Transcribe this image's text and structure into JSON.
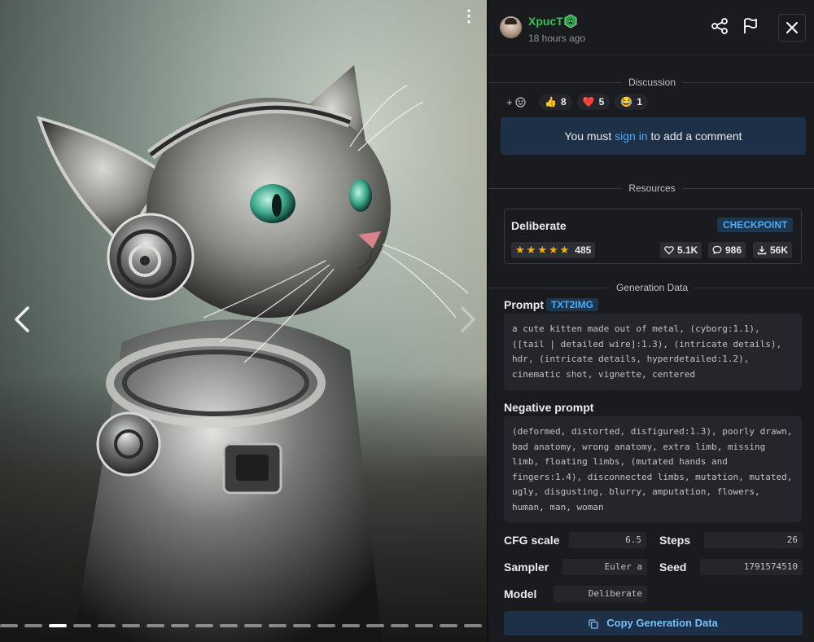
{
  "viewer": {
    "menu_glyph": "⋮",
    "image_count": 20,
    "active_index": 2
  },
  "header": {
    "username": "XpucT",
    "timestamp": "18 hours ago",
    "icons": [
      "share-icon",
      "flag-icon",
      "close-icon"
    ]
  },
  "discussion": {
    "title": "Discussion",
    "add_reaction": "+",
    "reactions": [
      {
        "emoji": "👍",
        "count": "8"
      },
      {
        "emoji": "❤️",
        "count": "5"
      },
      {
        "emoji": "😂",
        "count": "1"
      }
    ],
    "signin_prefix": "You must ",
    "signin_link": "sign in",
    "signin_suffix": " to add a comment"
  },
  "resources": {
    "title": "Resources",
    "item": {
      "name": "Deliberate",
      "type": "CHECKPOINT",
      "rating_count": "485",
      "likes": "5.1K",
      "comments": "986",
      "downloads": "56K"
    }
  },
  "generation": {
    "title": "Generation Data",
    "prompt_label": "Prompt",
    "prompt_type": "TXT2IMG",
    "prompt": "a cute kitten made out of metal, (cyborg:1.1),\n([tail | detailed wire]:1.3), (intricate details),\nhdr, (intricate details, hyperdetailed:1.2),\ncinematic shot, vignette, centered",
    "negative_label": "Negative prompt",
    "negative_prompt": "(deformed, distorted, disfigured:1.3), poorly drawn,\nbad anatomy, wrong anatomy, extra limb, missing\nlimb, floating limbs, (mutated hands and\nfingers:1.4), disconnected limbs, mutation, mutated,\nugly, disgusting, blurry, amputation, flowers,\nhuman, man, woman",
    "cfg_label": "CFG scale",
    "cfg_value": "6.5",
    "steps_label": "Steps",
    "steps_value": "26",
    "sampler_label": "Sampler",
    "sampler_value": "Euler a",
    "seed_label": "Seed",
    "seed_value": "1791574510",
    "model_label": "Model",
    "model_value": "Deliberate",
    "copy_label": "Copy Generation Data"
  },
  "colors": {
    "accent_blue": "#4dabf7",
    "username_green": "#40c057",
    "star_yellow": "#fab005",
    "panel_bg": "#1a1b1e"
  }
}
